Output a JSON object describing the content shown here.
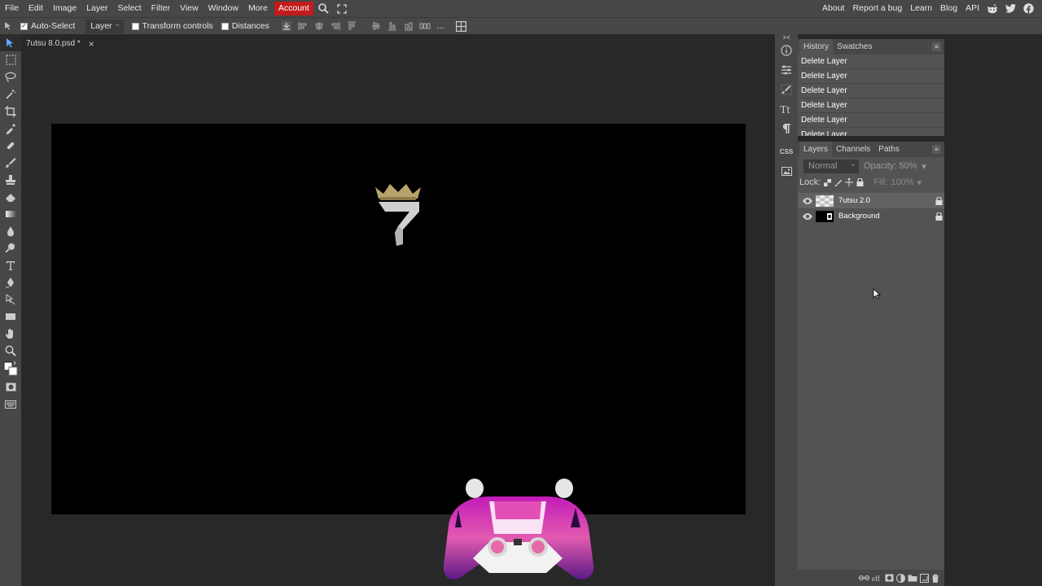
{
  "menu": {
    "items": [
      "File",
      "Edit",
      "Image",
      "Layer",
      "Select",
      "Filter",
      "View",
      "Window",
      "More"
    ],
    "account": "Account",
    "right_links": [
      "About",
      "Report a bug",
      "Learn",
      "Blog",
      "API"
    ],
    "accent": "#c11c1c"
  },
  "options": {
    "auto_select_label": "Auto-Select",
    "auto_select_checked": true,
    "select_mode": "Layer",
    "transform_label": "Transform controls",
    "distances_label": "Distances",
    "more": "..."
  },
  "document": {
    "tab_title": "7utsu 8.0.psd *",
    "close": "×",
    "canvas_bg": "#000000"
  },
  "history": {
    "tabs": [
      "History",
      "Swatches"
    ],
    "items": [
      "Delete Layer",
      "Delete Layer",
      "Delete Layer",
      "Delete Layer",
      "Delete Layer",
      "Delete Layer"
    ]
  },
  "layers": {
    "tabs": [
      "Layers",
      "Channels",
      "Paths"
    ],
    "blend_mode": "Normal",
    "opacity_label": "Opacity:",
    "opacity_value": "50%",
    "lock_label": "Lock:",
    "fill_label": "Fill:",
    "fill_value": "100%",
    "items": [
      {
        "name": "7utsu 2.0",
        "selected": true
      },
      {
        "name": "Background",
        "selected": false
      }
    ]
  },
  "rightbar": {
    "css_label": "CSS"
  }
}
